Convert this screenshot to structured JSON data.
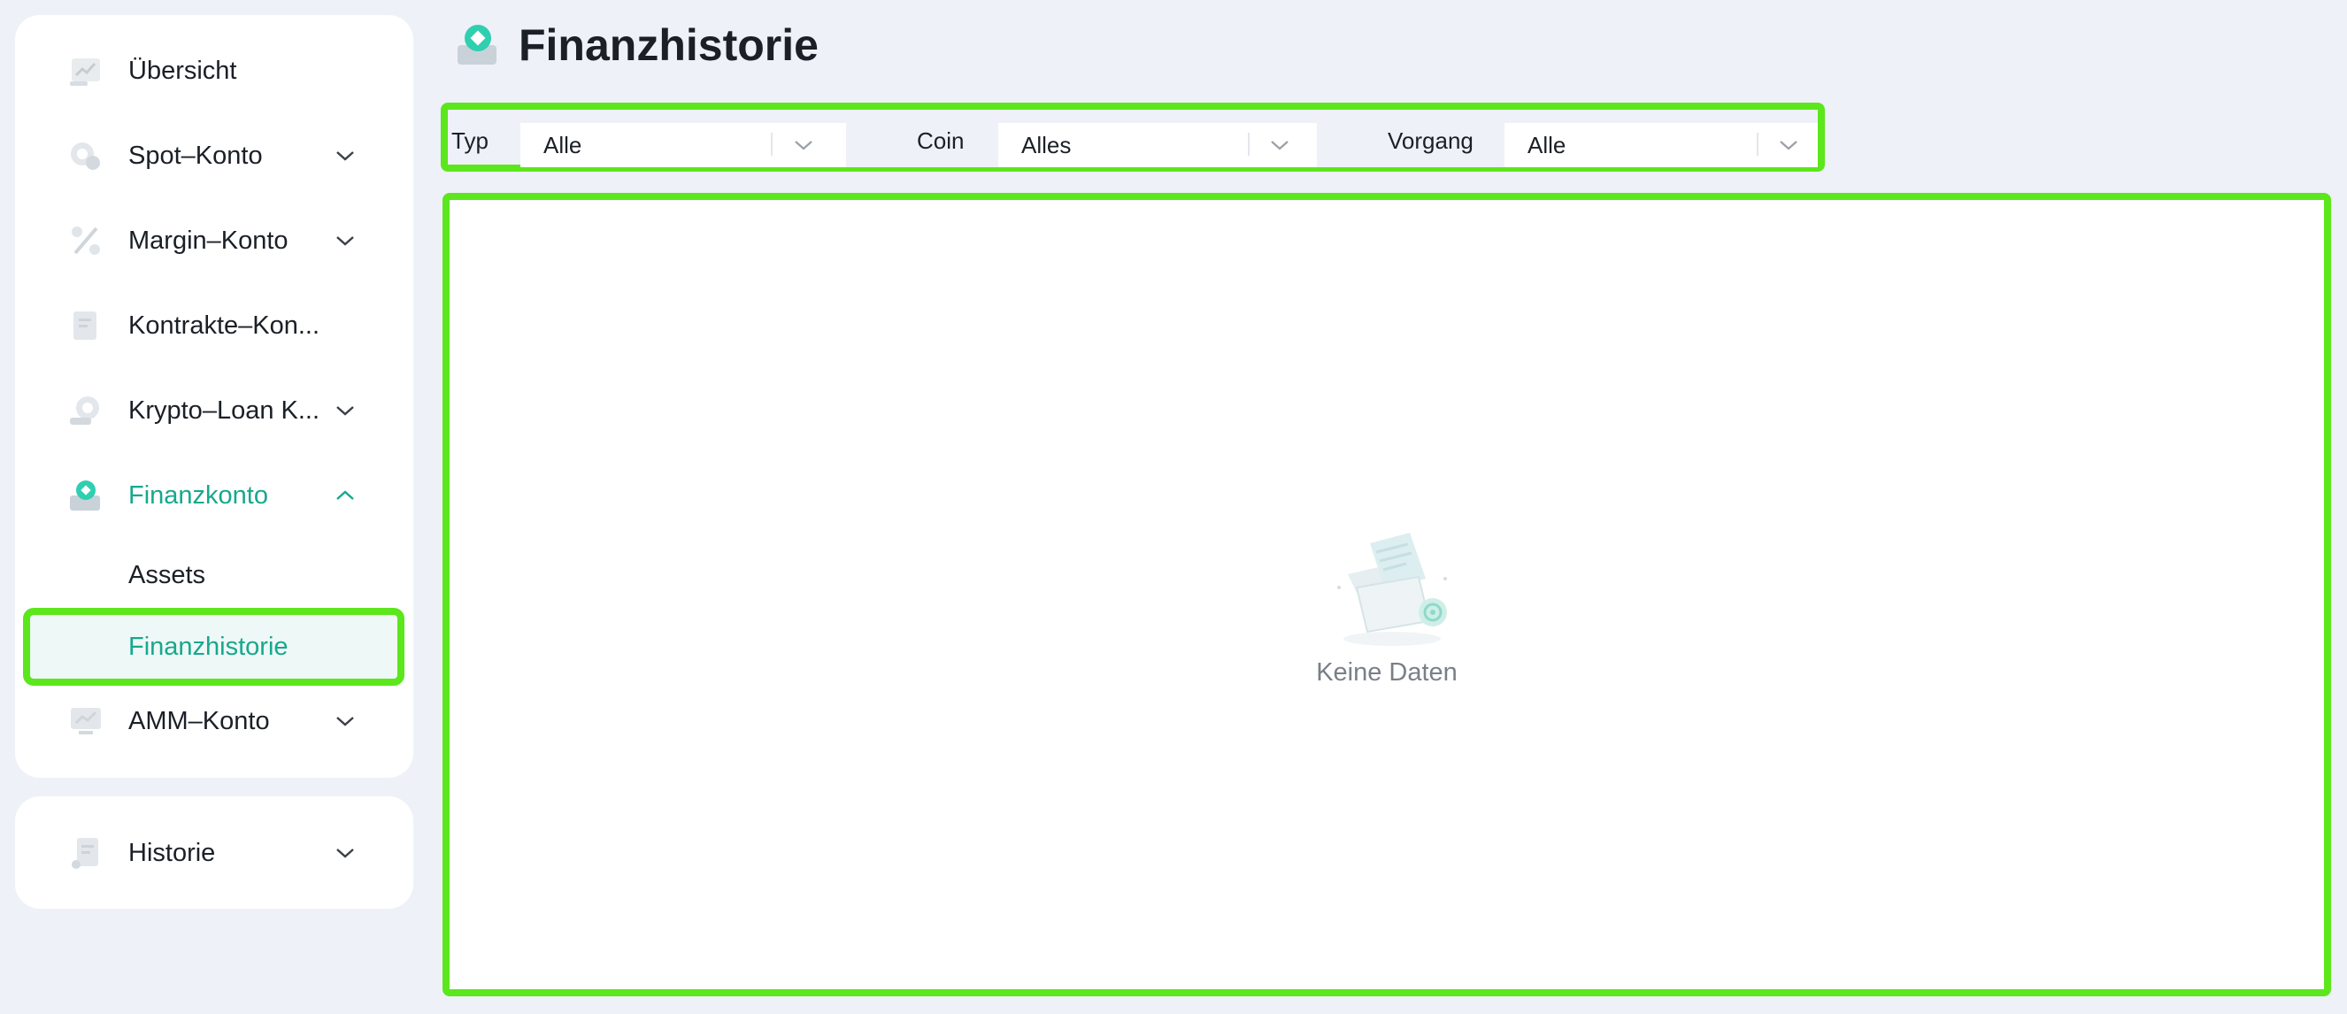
{
  "sidebar": {
    "items": [
      {
        "label": "Übersicht",
        "icon": "chart-icon",
        "has_chevron": false
      },
      {
        "label": "Spot–Konto",
        "icon": "coin-icon",
        "has_chevron": true
      },
      {
        "label": "Margin–Konto",
        "icon": "percent-icon",
        "has_chevron": true
      },
      {
        "label": "Kontrakte–Kon...",
        "icon": "document-icon",
        "has_chevron": false
      },
      {
        "label": "Krypto–Loan K...",
        "icon": "loan-icon",
        "has_chevron": true
      },
      {
        "label": "Finanzkonto",
        "icon": "finance-icon",
        "has_chevron": true,
        "expanded": true,
        "active": true
      }
    ],
    "sub_items": [
      {
        "label": "Assets"
      },
      {
        "label": "Finanzhistorie",
        "selected": true
      }
    ],
    "after_items": [
      {
        "label": "AMM–Konto",
        "icon": "monitor-icon",
        "has_chevron": true
      }
    ],
    "history": {
      "label": "Historie",
      "icon": "receipt-icon"
    }
  },
  "header": {
    "title": "Finanzhistorie",
    "icon": "finance-icon"
  },
  "filters": {
    "type_label": "Typ",
    "type_value": "Alle",
    "coin_label": "Coin",
    "coin_value": "Alles",
    "process_label": "Vorgang",
    "process_value": "Alle"
  },
  "content": {
    "empty_text": "Keine Daten"
  },
  "colors": {
    "accent": "#17a88d",
    "highlight": "#5ce61c",
    "background": "#eef1f8"
  }
}
